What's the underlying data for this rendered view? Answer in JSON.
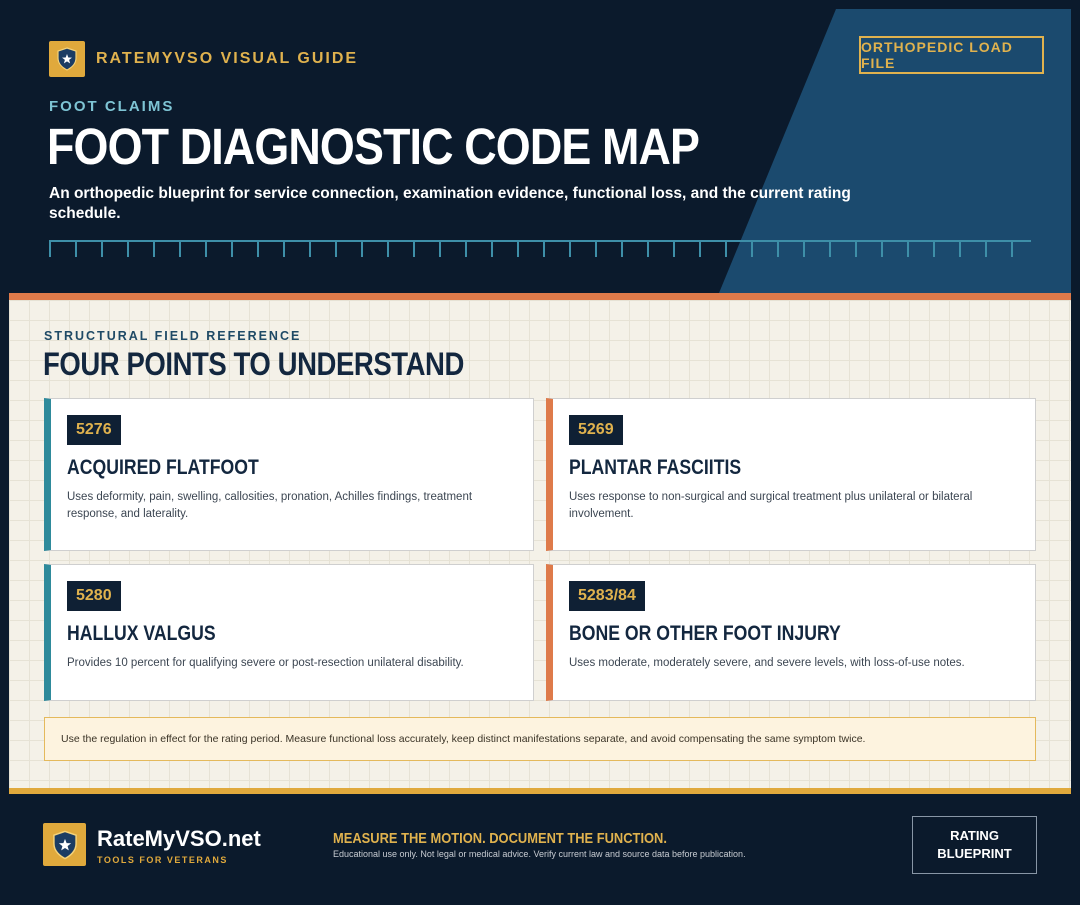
{
  "header": {
    "brand": "RATEMYVSO VISUAL GUIDE",
    "load_file_label": "ORTHOPEDIC LOAD FILE",
    "eyebrow": "FOOT CLAIMS",
    "title": "FOOT DIAGNOSTIC CODE MAP",
    "subtitle": "An orthopedic blueprint for service connection, examination evidence, functional loss, and the current rating schedule."
  },
  "section": {
    "eyebrow": "STRUCTURAL FIELD REFERENCE",
    "title": "FOUR POINTS TO UNDERSTAND"
  },
  "cards": [
    {
      "code": "5276",
      "title": "ACQUIRED FLATFOOT",
      "desc": "Uses deformity, pain, swelling, callosities, pronation, Achilles findings, treatment response, and laterality.",
      "accent": "#2e8a9b"
    },
    {
      "code": "5269",
      "title": "PLANTAR FASCIITIS",
      "desc": "Uses response to non-surgical and surgical treatment plus unilateral or bilateral involvement.",
      "accent": "#de7a4a"
    },
    {
      "code": "5280",
      "title": "HALLUX VALGUS",
      "desc": "Provides 10 percent for qualifying severe or post-resection unilateral disability.",
      "accent": "#2e8a9b"
    },
    {
      "code": "5283/84",
      "title": "BONE OR OTHER FOOT INJURY",
      "desc": "Uses moderate, moderately severe, and severe levels, with loss-of-use notes.",
      "accent": "#de7a4a"
    }
  ],
  "note": "Use the regulation in effect for the rating period. Measure functional loss accurately, keep distinct manifestations separate, and avoid compensating the same symptom twice.",
  "footer": {
    "site": "RateMyVSO.net",
    "tagline": "TOOLS FOR VETERANS",
    "motto": "MEASURE THE MOTION. DOCUMENT THE FUNCTION.",
    "disclaimer": "Educational use only. Not legal or medical advice. Verify current law and source data before publication.",
    "button_line1": "RATING",
    "button_line2": "BLUEPRINT"
  },
  "colors": {
    "navy": "#0b1a2c",
    "gold": "#e0a93c",
    "teal": "#2e8a9b",
    "orange": "#de7a4a"
  }
}
